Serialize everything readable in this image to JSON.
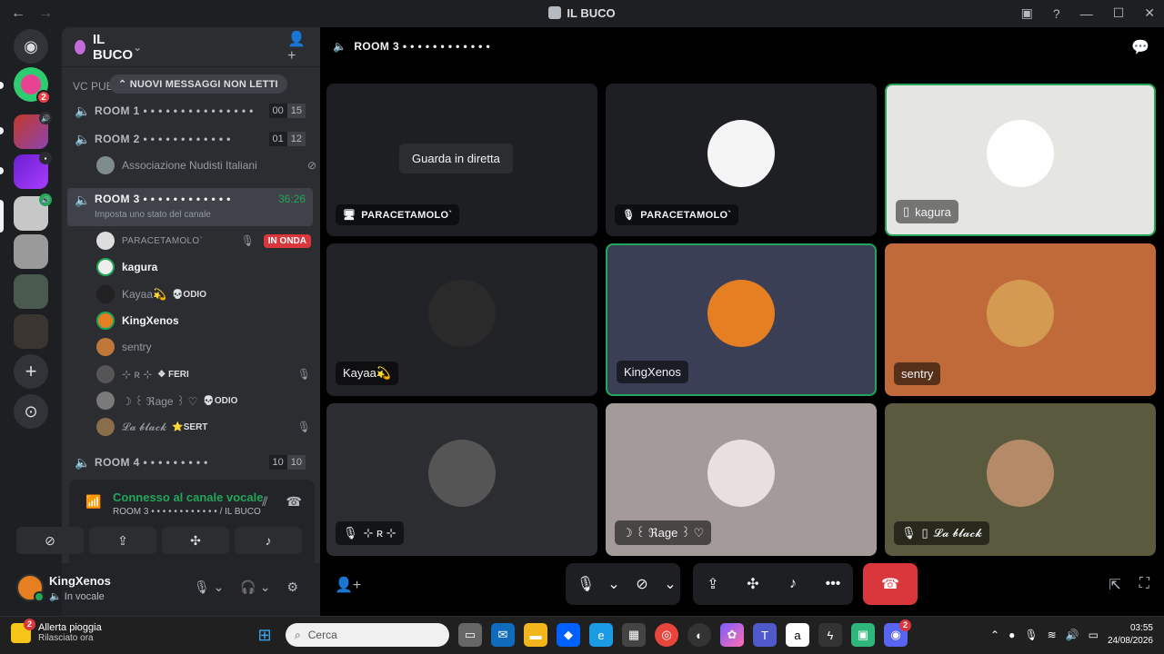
{
  "window": {
    "title": "IL BUCO"
  },
  "guild": {
    "name": "IL BUCO"
  },
  "category": {
    "label": "VC PUB"
  },
  "new_messages": {
    "label": "NUOVI MESSAGGI NON LETTI"
  },
  "channels": [
    {
      "name": "ROOM 1 • • • • • • • • • • • • • • •",
      "count_a": "00",
      "count_b": "15"
    },
    {
      "name": "ROOM 2 • • • • • • • • • • • •",
      "count_a": "01",
      "count_b": "12"
    },
    {
      "name": "ROOM 3 • • • • • • • • • • • •",
      "time": "36:26",
      "status": "Imposta uno stato del canale"
    },
    {
      "name": "ROOM 4 • • • • • • • • •",
      "count_a": "10",
      "count_b": "10"
    }
  ],
  "room2_users": [
    {
      "name": "Associazione Nudisti Italiani"
    }
  ],
  "room3_users": [
    {
      "name": "PARACETAMOLO`",
      "badge": "IN ONDA"
    },
    {
      "name": "kagura"
    },
    {
      "name": "Kayaa💫",
      "tag": "💀ODIO"
    },
    {
      "name": "KingXenos"
    },
    {
      "name": "sentry"
    },
    {
      "name": "⊹ ʀ ⊹",
      "tag": "❖ FERI"
    },
    {
      "name": "☽ ꒰ ℜage ꒱ ♡",
      "tag": "💀ODIO"
    },
    {
      "name": "𝓛𝓪 𝓫𝓵𝓪𝓬𝓴",
      "tag": "⭐SERT"
    }
  ],
  "voice_panel": {
    "status": "Connesso al canale vocale",
    "location": "ROOM 3 • • • • • • • • • • • • / IL BUCO"
  },
  "user": {
    "name": "KingXenos",
    "status": "In vocale"
  },
  "stage": {
    "channel": "ROOM 3 • • • • • • • • • • • •"
  },
  "tiles": [
    {
      "label": "PARACETAMOLO`",
      "watch": "Guarda in diretta"
    },
    {
      "label": "PARACETAMOLO`"
    },
    {
      "label": "kagura"
    },
    {
      "label": "Kayaa💫"
    },
    {
      "label": "KingXenos"
    },
    {
      "label": "sentry"
    },
    {
      "label": "⊹ ʀ ⊹"
    },
    {
      "label": "☽ ꒰ ℜage ꒱ ♡"
    },
    {
      "label": "𝓛𝓪 𝓫𝓵𝓪𝓬𝓴"
    }
  ],
  "taskbar": {
    "weather_title": "Allerta pioggia",
    "weather_sub": "Rilasciato ora",
    "weather_badge": "2",
    "search_placeholder": "Cerca",
    "time": "03:55",
    "date": "24/08/2026",
    "discord_badge": "2"
  },
  "colors": {
    "speaking": "#23a55a",
    "live": "#da373c",
    "blurple": "#5865f2"
  }
}
